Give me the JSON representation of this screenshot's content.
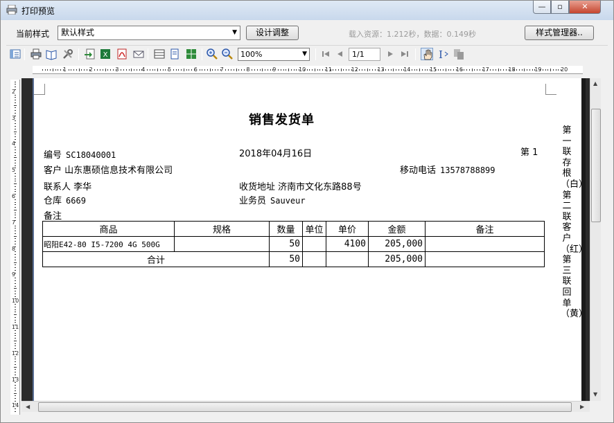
{
  "window": {
    "title": "打印预览"
  },
  "style_bar": {
    "label": "当前样式",
    "selected_style": "默认样式",
    "design_button": "设计调整",
    "load_info": "载入资源：1.212秒，数据：0.149秒",
    "manager_button": "样式管理器.."
  },
  "toolbar": {
    "zoom": "100%",
    "page": "1/1",
    "icons": [
      "list-icon",
      "print-icon",
      "book-icon",
      "tools-icon",
      "export-icon",
      "excel-icon",
      "pdf-icon",
      "email-icon",
      "page-layout-icon",
      "page-single-icon",
      "page-multi-icon",
      "zoom-in-icon",
      "zoom-out-icon",
      "first-page-icon",
      "prev-page-icon",
      "next-page-icon",
      "last-page-icon",
      "hand-icon",
      "text-select-icon",
      "copy-icon"
    ]
  },
  "document": {
    "title": "销售发货单",
    "number": {
      "label": "编号",
      "value": "SC18040001"
    },
    "date": "2018年04月16日",
    "page_label": "第 1",
    "customer": {
      "label": "客户",
      "value": "山东惠硕信息技术有限公司"
    },
    "mobile": {
      "label": "移动电话",
      "value": "13578788899"
    },
    "contact": {
      "label": "联系人",
      "value": "李华"
    },
    "address": {
      "label": "收货地址",
      "value": "济南市文化东路88号"
    },
    "warehouse": {
      "label": "仓库",
      "value": "6669"
    },
    "salesman": {
      "label": "业务员",
      "value": "Sauveur"
    },
    "remark_label": "备注",
    "copies_note": "第一联存根（白）第二联客户（红）第三联回单（黄）",
    "table": {
      "headers": [
        "商品",
        "规格",
        "数量",
        "单位",
        "单价",
        "金额",
        "备注"
      ],
      "rows": [
        {
          "product": "昭阳E42-80 I5-7200 4G 500G",
          "spec": "",
          "qty": "50",
          "unit": "",
          "price": "4100",
          "amount": "205,000",
          "remark": ""
        }
      ],
      "total": {
        "label": "合计",
        "qty": "50",
        "amount": "205,000"
      }
    }
  },
  "ruler": {
    "h_numbers": [
      "1",
      "2",
      "3",
      "4",
      "5",
      "6",
      "7",
      "8",
      "9",
      "10",
      "11",
      "12",
      "13",
      "14",
      "15",
      "16",
      "17",
      "18",
      "19",
      "20"
    ],
    "v_numbers": [
      "2",
      "3",
      "4",
      "5",
      "6",
      "7",
      "8",
      "9",
      "10",
      "11",
      "12",
      "13",
      "14"
    ]
  }
}
